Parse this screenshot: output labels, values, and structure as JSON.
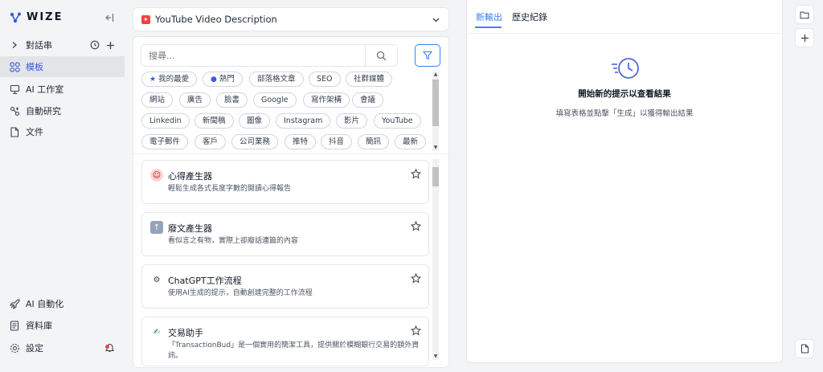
{
  "brand": {
    "name": "WIZE"
  },
  "sidebar": {
    "conversations_label": "對話串",
    "items": [
      {
        "label": "模板",
        "icon": "grid-icon",
        "active": true
      },
      {
        "label": "AI 工作室",
        "icon": "studio-icon"
      },
      {
        "label": "自動研究",
        "icon": "research-icon"
      },
      {
        "label": "文件",
        "icon": "file-icon"
      }
    ],
    "bottom": [
      {
        "label": "AI 自動化",
        "icon": "rocket-icon"
      },
      {
        "label": "資料庫",
        "icon": "database-icon"
      },
      {
        "label": "設定",
        "icon": "gear-icon"
      }
    ]
  },
  "template_select": {
    "value": "YouTube Video Description"
  },
  "search": {
    "placeholder": "搜尋..."
  },
  "tags": [
    {
      "label": "我的最愛",
      "icon": "★"
    },
    {
      "label": "熱門",
      "icon": "●"
    },
    {
      "label": "部落格文章"
    },
    {
      "label": "SEO"
    },
    {
      "label": "社群媒體"
    },
    {
      "label": "網站"
    },
    {
      "label": "廣告"
    },
    {
      "label": "臉書"
    },
    {
      "label": "Google"
    },
    {
      "label": "寫作架構"
    },
    {
      "label": "會議"
    },
    {
      "label": "Linkedin"
    },
    {
      "label": "新聞稿"
    },
    {
      "label": "圖像"
    },
    {
      "label": "Instagram"
    },
    {
      "label": "影片"
    },
    {
      "label": "YouTube"
    },
    {
      "label": "電子郵件"
    },
    {
      "label": "客戶"
    },
    {
      "label": "公司業務"
    },
    {
      "label": "推特"
    },
    {
      "label": "抖音"
    },
    {
      "label": "簡訊"
    },
    {
      "label": "最新"
    }
  ],
  "cards": [
    {
      "title": "心得產生器",
      "desc": "輕鬆生成各式長度字數的閱讀心得報告",
      "icon": "☺",
      "icon_bg": "#f9d5d3"
    },
    {
      "title": "廢文產生器",
      "desc": "看似言之有物，實際上卻廢話連篇的內容",
      "icon": "↑",
      "icon_bg": "#cbd5e1"
    },
    {
      "title": "ChatGPT工作流程",
      "desc": "使用AI生成的提示，自動創建完整的工作流程",
      "icon": "⚙",
      "icon_bg": "#ffffff"
    },
    {
      "title": "交易助手",
      "desc": "「TransactionBud」是一個實用的簡潔工具，提供關於模糊銀行交易的額外資訊。",
      "icon": "✍",
      "icon_bg": "#ffffff"
    }
  ],
  "output": {
    "tabs": [
      "新輸出",
      "歷史紀錄"
    ],
    "empty_title": "開始新的提示以查看結果",
    "empty_subtitle": "填寫表格並點擊「生成」以獲得輸出結果"
  },
  "colors": {
    "accent": "#3b82f6",
    "active_nav": "#3b5bdb"
  }
}
